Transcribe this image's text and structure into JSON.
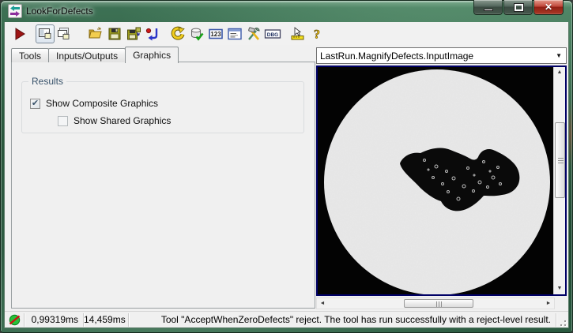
{
  "window": {
    "title": "LookForDefects",
    "controls": [
      {
        "name": "minimize"
      },
      {
        "name": "maximize"
      },
      {
        "name": "close"
      }
    ]
  },
  "glyphs": {
    "check": "✔",
    "dropdown": "▼",
    "scroll_up": "▲",
    "scroll_down": "▼",
    "scroll_left": "◄",
    "scroll_right": "►",
    "close": "✕"
  },
  "toolbar": {
    "icons": [
      "run",
      "show-control",
      "show-control-window",
      "open-file",
      "save-file",
      "save-as",
      "reset",
      "undo",
      "results-database",
      "numeric-results",
      "property-sheet",
      "tool-settings",
      "debug",
      "profiler",
      "help"
    ],
    "glyphs": {
      "numeric": "123",
      "debug": "DBG",
      "help": "?"
    }
  },
  "tabs": {
    "items": [
      {
        "label": "Tools",
        "selected": false
      },
      {
        "label": "Inputs/Outputs",
        "selected": false
      },
      {
        "label": "Graphics",
        "selected": true
      }
    ]
  },
  "graphics_page": {
    "group_title": "Results",
    "composite_label": "Show Composite Graphics",
    "composite_checked": true,
    "shared_label": "Show Shared Graphics",
    "shared_checked": false
  },
  "display": {
    "source_selector": "LastRun.MagnifyDefects.InputImage"
  },
  "status_bar": {
    "execution_time": "0,99319ms",
    "total_time": "14,459ms",
    "message": "Tool \"AcceptWhenZeroDefects\" reject. The tool has run successfully with a reject-level result."
  }
}
